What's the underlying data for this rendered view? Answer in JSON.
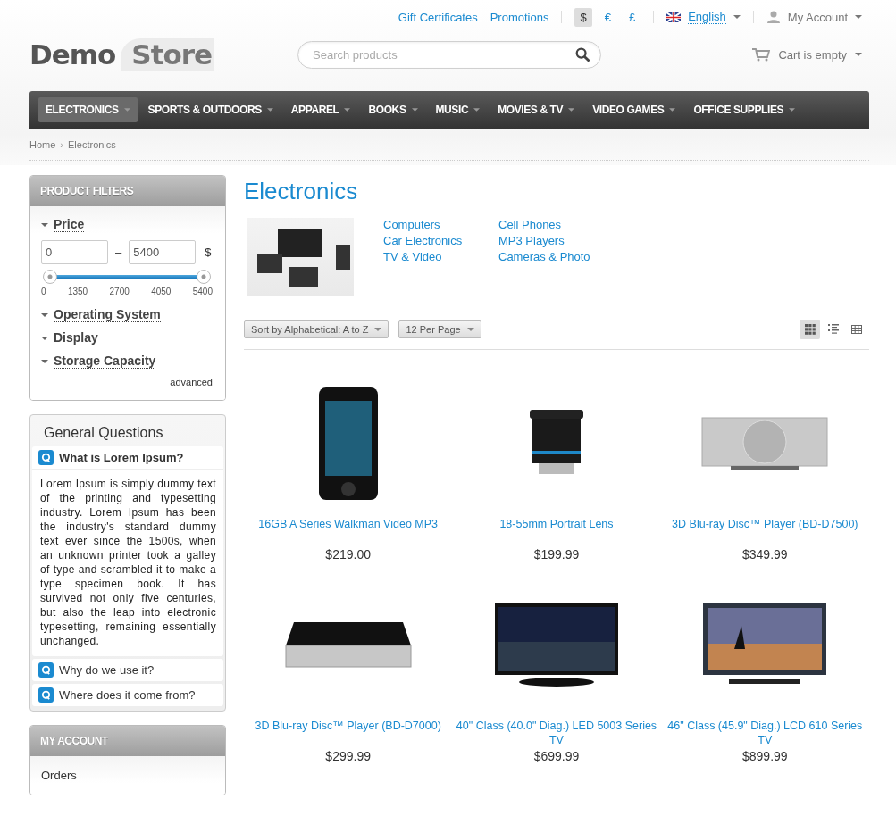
{
  "top_links": [
    "Gift Certificates",
    "Promotions"
  ],
  "currencies": [
    {
      "label": "$",
      "selected": true
    },
    {
      "label": "€",
      "selected": false
    },
    {
      "label": "£",
      "selected": false
    }
  ],
  "language": "English",
  "account": "My Account",
  "logo": {
    "first": "Demo",
    "second": "Store"
  },
  "search": {
    "placeholder": "Search products"
  },
  "cart": "Cart is empty",
  "nav": [
    {
      "label": "ELECTRONICS",
      "selected": true
    },
    {
      "label": "SPORTS & OUTDOORS",
      "selected": false
    },
    {
      "label": "APPAREL",
      "selected": false
    },
    {
      "label": "BOOKS",
      "selected": false
    },
    {
      "label": "MUSIC",
      "selected": false
    },
    {
      "label": "MOVIES & TV",
      "selected": false
    },
    {
      "label": "VIDEO GAMES",
      "selected": false
    },
    {
      "label": "OFFICE SUPPLIES",
      "selected": false
    }
  ],
  "breadcrumb": [
    "Home",
    "Electronics"
  ],
  "breadcrumb_separator": "›",
  "filters": {
    "title": "PRODUCT FILTERS",
    "price": {
      "label": "Price",
      "min": "0",
      "range_dash": "–",
      "max": "5400",
      "currency": "$",
      "level": 1,
      "ticks": [
        "0",
        "1350",
        "2700",
        "4050",
        "5400"
      ]
    },
    "groups": [
      "Operating System",
      "Display",
      "Storage Capacity"
    ],
    "advanced": "advanced"
  },
  "faq": {
    "title": "General Questions",
    "items": [
      {
        "question": "What is Lorem Ipsum?",
        "expanded": true,
        "answer": "Lorem Ipsum is simply dummy text of the printing and typesetting industry. Lorem Ipsum has been the industry's standard dummy text ever since the 1500s, when an unknown printer took a galley of type and scrambled it to make a type specimen book. It has survived not only five centuries, but also the leap into electronic typesetting, remaining essentially unchanged."
      },
      {
        "question": "Why do we use it?",
        "expanded": false
      },
      {
        "question": "Where does it come from?",
        "expanded": false
      }
    ]
  },
  "my_account": {
    "title": "MY ACCOUNT",
    "items": [
      "Orders"
    ]
  },
  "category": {
    "title": "Electronics",
    "subcategories": [
      "Computers",
      "Car Electronics",
      "TV & Video",
      "Cell Phones",
      "MP3 Players",
      "Cameras & Photo"
    ]
  },
  "sort": "Sort by Alphabetical: A to Z",
  "per_page": "12 Per Page",
  "views": [
    {
      "kind": "grid",
      "selected": true
    },
    {
      "kind": "list",
      "selected": false
    },
    {
      "kind": "table",
      "selected": false
    }
  ],
  "products": [
    {
      "kind": "player",
      "name": "16GB A Series Walkman Video MP3",
      "price": "$219.00"
    },
    {
      "kind": "lens",
      "name": "18-55mm Portrait Lens",
      "price": "$199.99"
    },
    {
      "kind": "bluray",
      "name": "3D Blu-ray Disc™ Player (BD-D7500)",
      "price": "$349.99"
    },
    {
      "kind": "box",
      "name": "3D Blu-ray Disc™ Player (BD-D7000)",
      "price": "$299.99"
    },
    {
      "kind": "tv",
      "name": "40\" Class (40.0\" Diag.) LED 5003 Series TV",
      "price": "$699.99"
    },
    {
      "kind": "tv2",
      "name": "46\" Class (45.9\" Diag.) LCD 610 Series TV",
      "price": "$899.99"
    }
  ]
}
